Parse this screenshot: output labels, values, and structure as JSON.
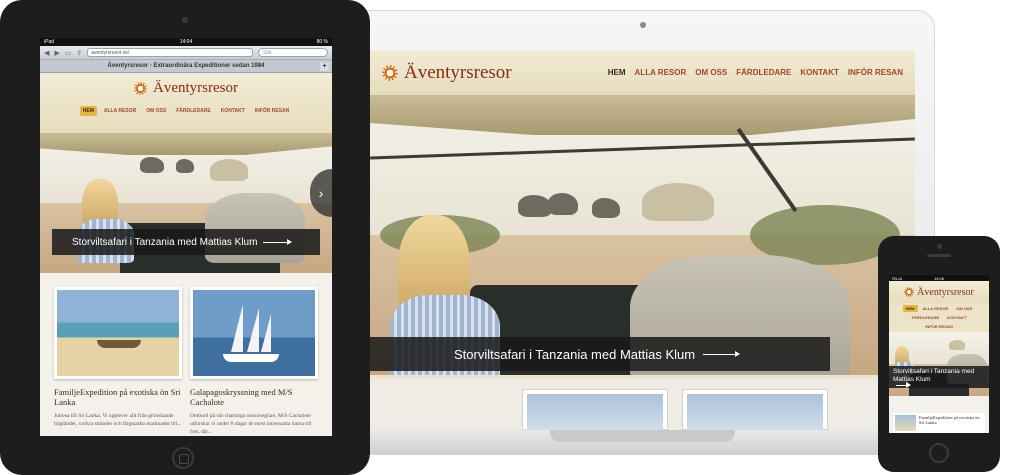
{
  "site": {
    "logo_text": "Äventyrsresor",
    "nav": [
      "HEM",
      "ALLA RESOR",
      "OM OSS",
      "FÄRDLEDARE",
      "KONTAKT",
      "INFÖR RESAN"
    ],
    "hero_caption": "Storviltsafari i Tanzania med Mattias Klum"
  },
  "tablet": {
    "status": {
      "left": "iPad",
      "time": "14:04",
      "right": "80 %"
    },
    "browser": {
      "url": "aventyrsresor.se/",
      "search_placeholder": "Sök",
      "page_title": "Äventyrsresor - Extraordinära Expeditioner sedan 1984"
    },
    "cards": [
      {
        "title": "FamiljeExpedition på exotiska ön Sri Lanka",
        "text": "Julresa till Sri Lanka. Vi upplever allt från grönskande högländer, vackra stränder och färgstarka marknader till..."
      },
      {
        "title": "Galapagoskryssning med M/S Cachalote",
        "text": "Ombord på vår charmiga motorseglare, M/S Cachalote utforskar vi under 8 dagar de mest intressanta öarna till fots, där..."
      }
    ]
  },
  "phone": {
    "status": {
      "left": "TELIA",
      "time": "14:06"
    },
    "card_text": "FamiljeExpedition på exotiska ön Sri Lanka"
  },
  "colors": {
    "accent": "#e7b43d",
    "brand": "#8b2a12",
    "header_bg": "#f2ecd5"
  }
}
